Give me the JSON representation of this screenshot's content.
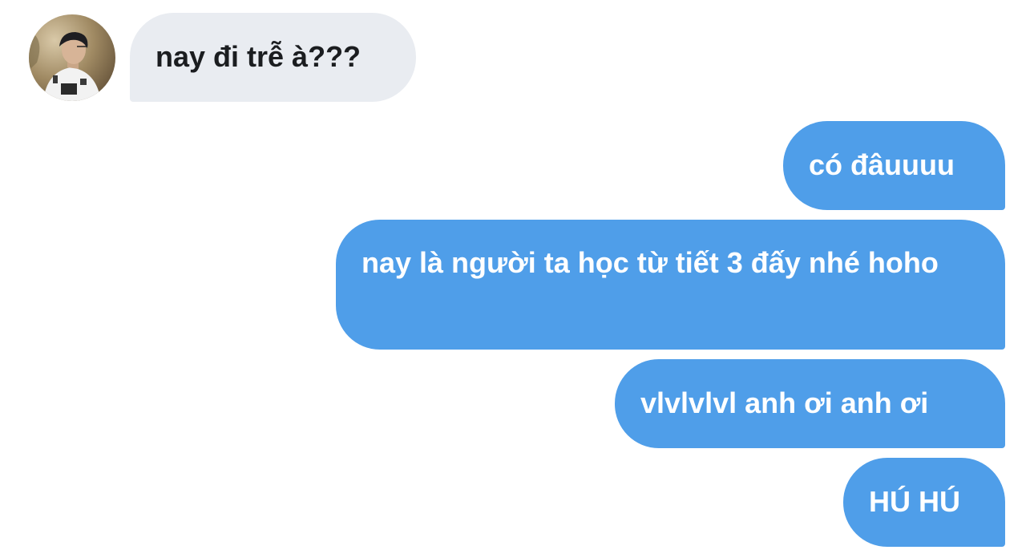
{
  "colors": {
    "received_bubble": "#e9ecf1",
    "sent_bubble": "#4f9ee9",
    "received_text": "#1b1d20",
    "sent_text": "#ffffff"
  },
  "contact": {
    "avatar": "contact-avatar-photo"
  },
  "messages": [
    {
      "direction": "received",
      "text": "nay đi trễ à???"
    },
    {
      "direction": "sent",
      "text": "có đâuuuu"
    },
    {
      "direction": "sent",
      "text": "nay là người ta học từ tiết 3 đấy nhé hoho"
    },
    {
      "direction": "sent",
      "text": "vlvlvlvl anh ơi anh ơi"
    },
    {
      "direction": "sent",
      "text": "HÚ HÚ"
    }
  ]
}
